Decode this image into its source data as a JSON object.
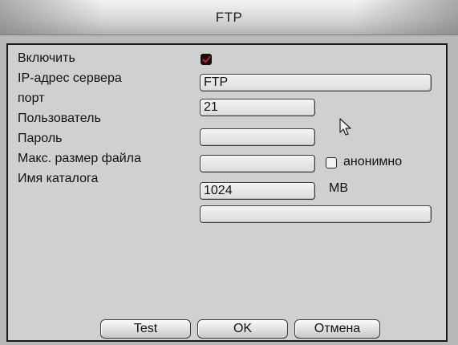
{
  "window": {
    "title": "FTP"
  },
  "form": {
    "enable": {
      "label": "Включить",
      "checked": true,
      "check_color": "#d11818"
    },
    "server_ip": {
      "label": "IP-адрес сервера",
      "value": "FTP"
    },
    "port": {
      "label": "порт",
      "value": "21"
    },
    "user": {
      "label": "Пользователь",
      "value": ""
    },
    "password": {
      "label": "Пароль",
      "value": ""
    },
    "anonymous": {
      "label": "анонимно",
      "checked": false
    },
    "max_file_size": {
      "label": "Макс. размер файла",
      "value": "1024",
      "unit": "MB"
    },
    "directory": {
      "label": "Имя каталога",
      "value": ""
    }
  },
  "buttons": {
    "test": "Test",
    "ok": "OK",
    "cancel": "Отмена"
  },
  "icons": {
    "cursor": "mouse-pointer-icon",
    "check": "checkmark-icon"
  }
}
